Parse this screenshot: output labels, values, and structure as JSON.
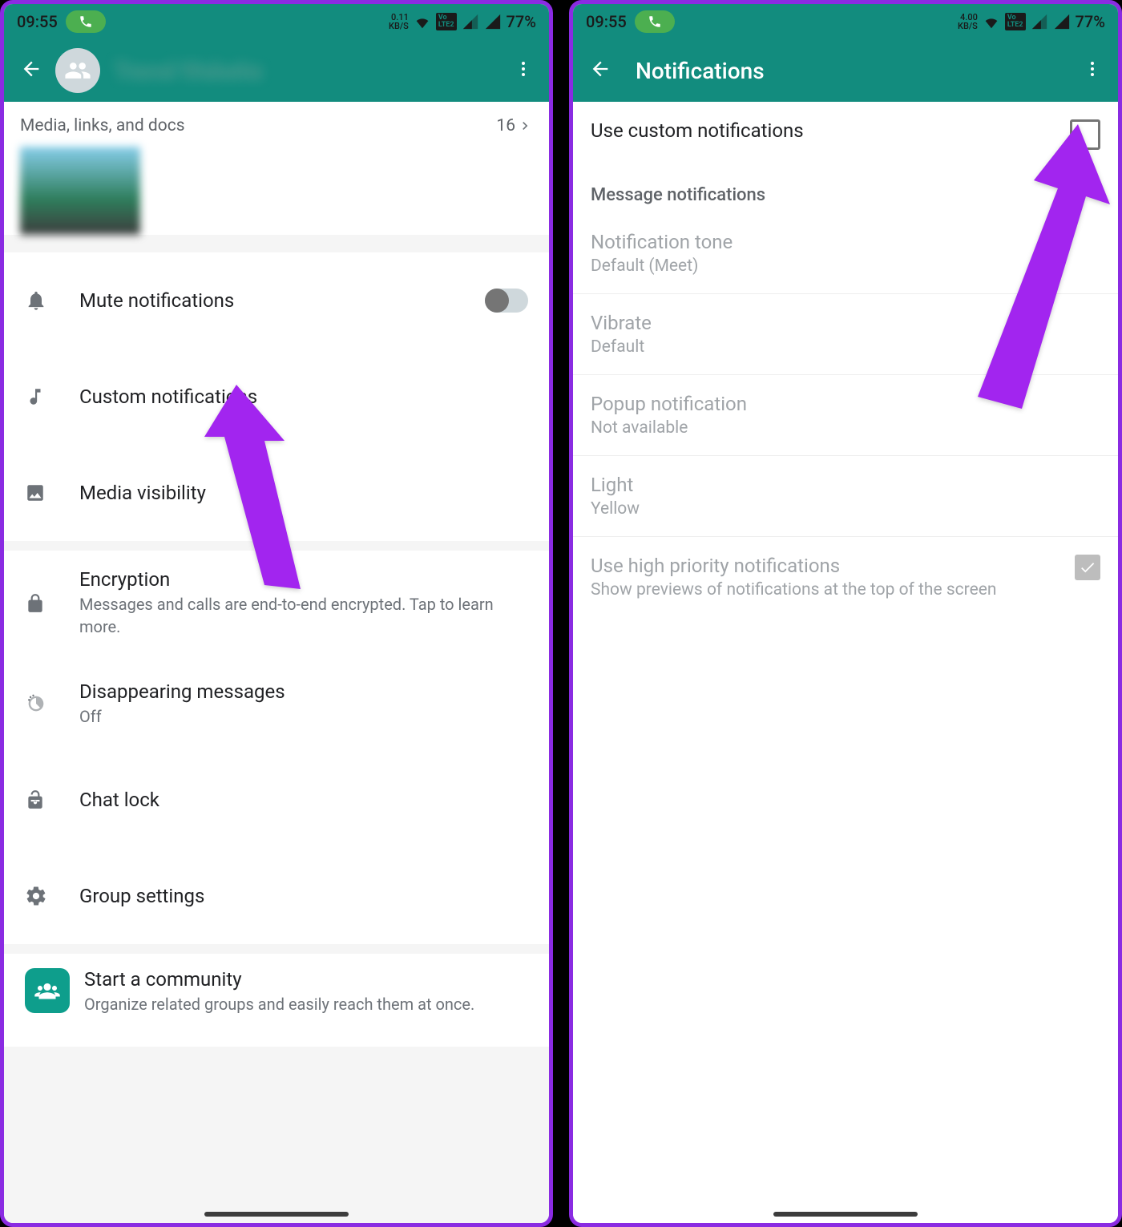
{
  "status": {
    "time": "09:55",
    "kbs_left": "0.11",
    "kbs_right": "4.00",
    "kbs_unit": "KB/S",
    "lte": "VoLTE2",
    "battery": "77%"
  },
  "left": {
    "title_blurred": "Travel Website",
    "media": {
      "header": "Media, links, and docs",
      "count": "16"
    },
    "rows": {
      "mute": "Mute notifications",
      "custom": "Custom notifications",
      "media_vis": "Media visibility",
      "encryption": {
        "label": "Encryption",
        "sub": "Messages and calls are end-to-end encrypted. Tap to learn more."
      },
      "disappearing": {
        "label": "Disappearing messages",
        "sub": "Off"
      },
      "chatlock": "Chat lock",
      "groupsettings": "Group settings",
      "community": {
        "label": "Start a community",
        "sub": "Organize related groups and easily reach them at once."
      }
    }
  },
  "right": {
    "title": "Notifications",
    "use_custom": "Use custom notifications",
    "section": "Message notifications",
    "tone": {
      "label": "Notification tone",
      "sub": "Default (Meet)"
    },
    "vibrate": {
      "label": "Vibrate",
      "sub": "Default"
    },
    "popup": {
      "label": "Popup notification",
      "sub": "Not available"
    },
    "light": {
      "label": "Light",
      "sub": "Yellow"
    },
    "highprio": {
      "label": "Use high priority notifications",
      "sub": "Show previews of notifications at the top of the screen"
    }
  }
}
